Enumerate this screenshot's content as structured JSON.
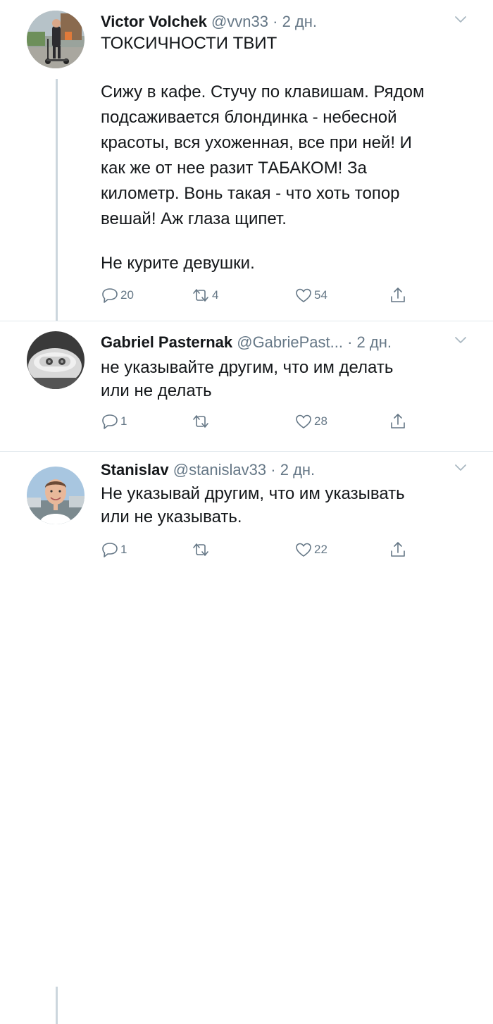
{
  "tweets": [
    {
      "author_name": "Victor Volchek",
      "handle": "@vvn33",
      "separator": "·",
      "time": "2 дн.",
      "text_title": "ТОКСИЧНОСТИ ТВИТ",
      "text_body": "Сижу в кафе. Стучу по клавишам. Рядом\nподсаживается блондинка - небесной\nкрасоты, вся ухоженная, все при ней! И\nкак же от нее разит ТАБАКОМ! За\nкилометр. Вонь такая - что хоть топор\nвешай! Аж глаза щипет.",
      "text_end": "Не курите девушки.",
      "replies": "20",
      "retweets": "4",
      "likes": "54"
    },
    {
      "author_name": "Gabriel Pasternak",
      "handle": "@GabriePast...",
      "separator": "·",
      "time": "2 дн.",
      "text": "не указывайте другим, что им делать\nили не делать",
      "replies": "1",
      "retweets": "",
      "likes": "28"
    },
    {
      "author_name": "Stanislav",
      "handle": "@stanislav33",
      "separator": "·",
      "time": "2 дн.",
      "text": "Не указывай другим, что им указывать\nили не указывать.",
      "replies": "1",
      "retweets": "",
      "likes": "22"
    }
  ],
  "icons": {
    "reply": "reply-icon",
    "retweet": "retweet-icon",
    "like": "heart-icon",
    "share": "share-icon",
    "menu": "chevron-down-icon"
  },
  "colors": {
    "text": "#14171a",
    "secondary": "#657786",
    "thread_line": "#ccd6dd",
    "separator": "#e1e8ed"
  }
}
